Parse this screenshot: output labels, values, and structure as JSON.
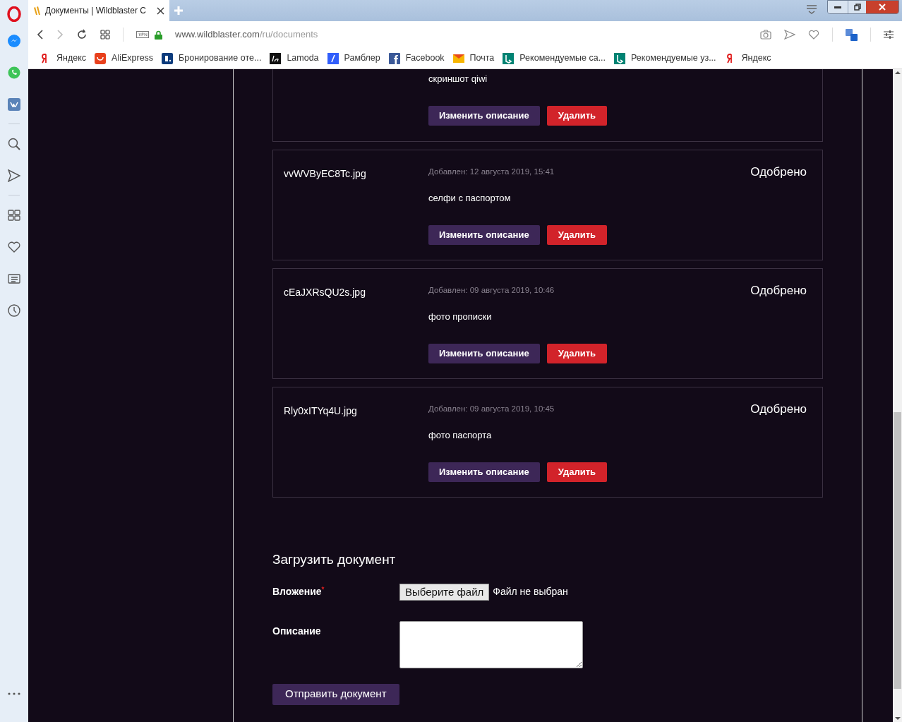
{
  "browser": {
    "tab": {
      "title": "Документы | Wildblaster C",
      "selected": true
    },
    "address": {
      "host": "www.wildblaster.com",
      "path": "/ru/documents"
    },
    "bookmarks": [
      {
        "kind": "yandex",
        "label": "Яндекс"
      },
      {
        "kind": "aliexpress",
        "label": "AliExpress"
      },
      {
        "kind": "booking",
        "label": "Бронирование оте..."
      },
      {
        "kind": "lamoda",
        "label": "Lamoda"
      },
      {
        "kind": "rambler",
        "label": "Рамблер"
      },
      {
        "kind": "facebook",
        "label": "Facebook"
      },
      {
        "kind": "mail",
        "label": "Почта"
      },
      {
        "kind": "bing",
        "label": "Рекомендуемые са..."
      },
      {
        "kind": "bing",
        "label": "Рекомендуемые уз..."
      },
      {
        "kind": "yandex",
        "label": "Яндекс"
      }
    ],
    "sidebar": [
      {
        "kind": "messenger"
      },
      {
        "kind": "whatsapp"
      },
      {
        "kind": "vk"
      },
      {
        "kind": "separator"
      },
      {
        "kind": "search"
      },
      {
        "kind": "send"
      },
      {
        "kind": "separator"
      },
      {
        "kind": "grid"
      },
      {
        "kind": "heart"
      },
      {
        "kind": "news"
      },
      {
        "kind": "clock"
      }
    ]
  },
  "documents": [
    {
      "kind": "cut",
      "description": "скриншот qiwi",
      "edit": "Изменить описание",
      "delete": "Удалить"
    },
    {
      "kind": "full",
      "filename": "vvWVByEC8Tc.jpg",
      "added": "Добавлен: 12 августа 2019, 15:41",
      "status": "Одобрено",
      "description": "селфи с паспортом",
      "edit": "Изменить описание",
      "delete": "Удалить"
    },
    {
      "kind": "full",
      "filename": "cEaJXRsQU2s.jpg",
      "added": "Добавлен: 09 августа 2019, 10:46",
      "status": "Одобрено",
      "description": "фото прописки",
      "edit": "Изменить описание",
      "delete": "Удалить"
    },
    {
      "kind": "full",
      "filename": "Rly0xITYq4U.jpg",
      "added": "Добавлен: 09 августа 2019, 10:45",
      "status": "Одобрено",
      "description": "фото паспорта",
      "edit": "Изменить описание",
      "delete": "Удалить"
    }
  ],
  "upload": {
    "title": "Загрузить документ",
    "attachment": {
      "label": "Вложение",
      "required": true,
      "required_mark": "*",
      "button": "Выберите файл",
      "file_status": "Файл не выбран"
    },
    "description": {
      "label": "Описание"
    },
    "submit": "Отправить документ"
  }
}
